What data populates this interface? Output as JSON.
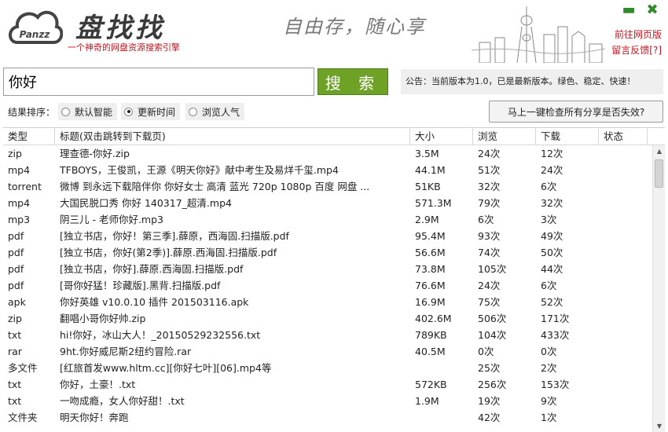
{
  "header": {
    "brand": "盘找找",
    "logo_text": "Panzz",
    "tagline": "一个神奇的网盘资源搜索引擎",
    "slogan": "自由存，随心享",
    "links": [
      "前往网页版",
      "留言反馈[?]"
    ],
    "minimize_icon": "minimize-icon",
    "close_icon": "close-icon"
  },
  "search": {
    "query": "你好",
    "button_label": "搜 索",
    "notice": "公告：当前版本为1.0，已是最新版本。绿色、稳定、快速！"
  },
  "sort": {
    "label": "结果排序：",
    "options": [
      {
        "label": "默认智能",
        "selected": false
      },
      {
        "label": "更新时间",
        "selected": true
      },
      {
        "label": "浏览人气",
        "selected": false
      }
    ],
    "check_button": "马上一键检查所有分享是否失效?"
  },
  "table": {
    "columns": [
      "类型",
      "标题(双击跳转到下载页)",
      "大小",
      "浏览",
      "下载",
      "状态"
    ],
    "rows": [
      [
        "zip",
        "理查德-你好.zip",
        "3.5M",
        "24次",
        "12次",
        ""
      ],
      [
        "mp4",
        "TFBOYS，王俊凯，王源《明天你好》献中考生及易烊千玺.mp4",
        "44.1M",
        "51次",
        "24次",
        ""
      ],
      [
        "torrent",
        "微博 到永远下载陪伴你 你好女士 高清 蓝光 720p 1080p 百度 网盘 ...",
        "51KB",
        "32次",
        "6次",
        ""
      ],
      [
        "mp4",
        "大国民脱口秀 你好 140317_超清.mp4",
        "571.3M",
        "79次",
        "32次",
        ""
      ],
      [
        "mp3",
        "阴三儿 - 老师你好.mp3",
        "2.9M",
        "6次",
        "3次",
        ""
      ],
      [
        "pdf",
        "[独立书店，你好！第三季].薛原，西海固.扫描版.pdf",
        "95.4M",
        "93次",
        "49次",
        ""
      ],
      [
        "pdf",
        "[独立书店，你好(第2季)].薛原.西海固.扫描版.pdf",
        "56.6M",
        "74次",
        "50次",
        ""
      ],
      [
        "pdf",
        "[独立书店，你好].薛原.西海固.扫描版.pdf",
        "73.8M",
        "105次",
        "44次",
        ""
      ],
      [
        "pdf",
        "[哥你好猛！珍藏版].黑背.扫描版.pdf",
        "76.6M",
        "24次",
        "6次",
        ""
      ],
      [
        "apk",
        "你好英雄 v10.0.10 插件 201503116.apk",
        "16.9M",
        "75次",
        "52次",
        ""
      ],
      [
        "zip",
        "翻唱小哥你好帅.zip",
        "402.6M",
        "506次",
        "171次",
        ""
      ],
      [
        "txt",
        "hi!你好，冰山大人！_20150529232556.txt",
        "789KB",
        "104次",
        "433次",
        ""
      ],
      [
        "rar",
        "9ht.你好威尼斯2纽约冒险.rar",
        "40.5M",
        "0次",
        "0次",
        ""
      ],
      [
        "多文件",
        "[红旅首发www.hltm.cc][你好七叶][06].mp4等",
        "",
        "25次",
        "2次",
        ""
      ],
      [
        "txt",
        "你好，土豪！.txt",
        "572KB",
        "256次",
        "153次",
        ""
      ],
      [
        "txt",
        "一吻成瘾，女人你好甜！.txt",
        "1.9M",
        "19次",
        "9次",
        ""
      ],
      [
        "文件夹",
        "明天你好！奔跑",
        "",
        "42次",
        "1次",
        ""
      ]
    ]
  },
  "colors": {
    "accent_green": "#6ea227",
    "brand_red": "#c0141e"
  }
}
